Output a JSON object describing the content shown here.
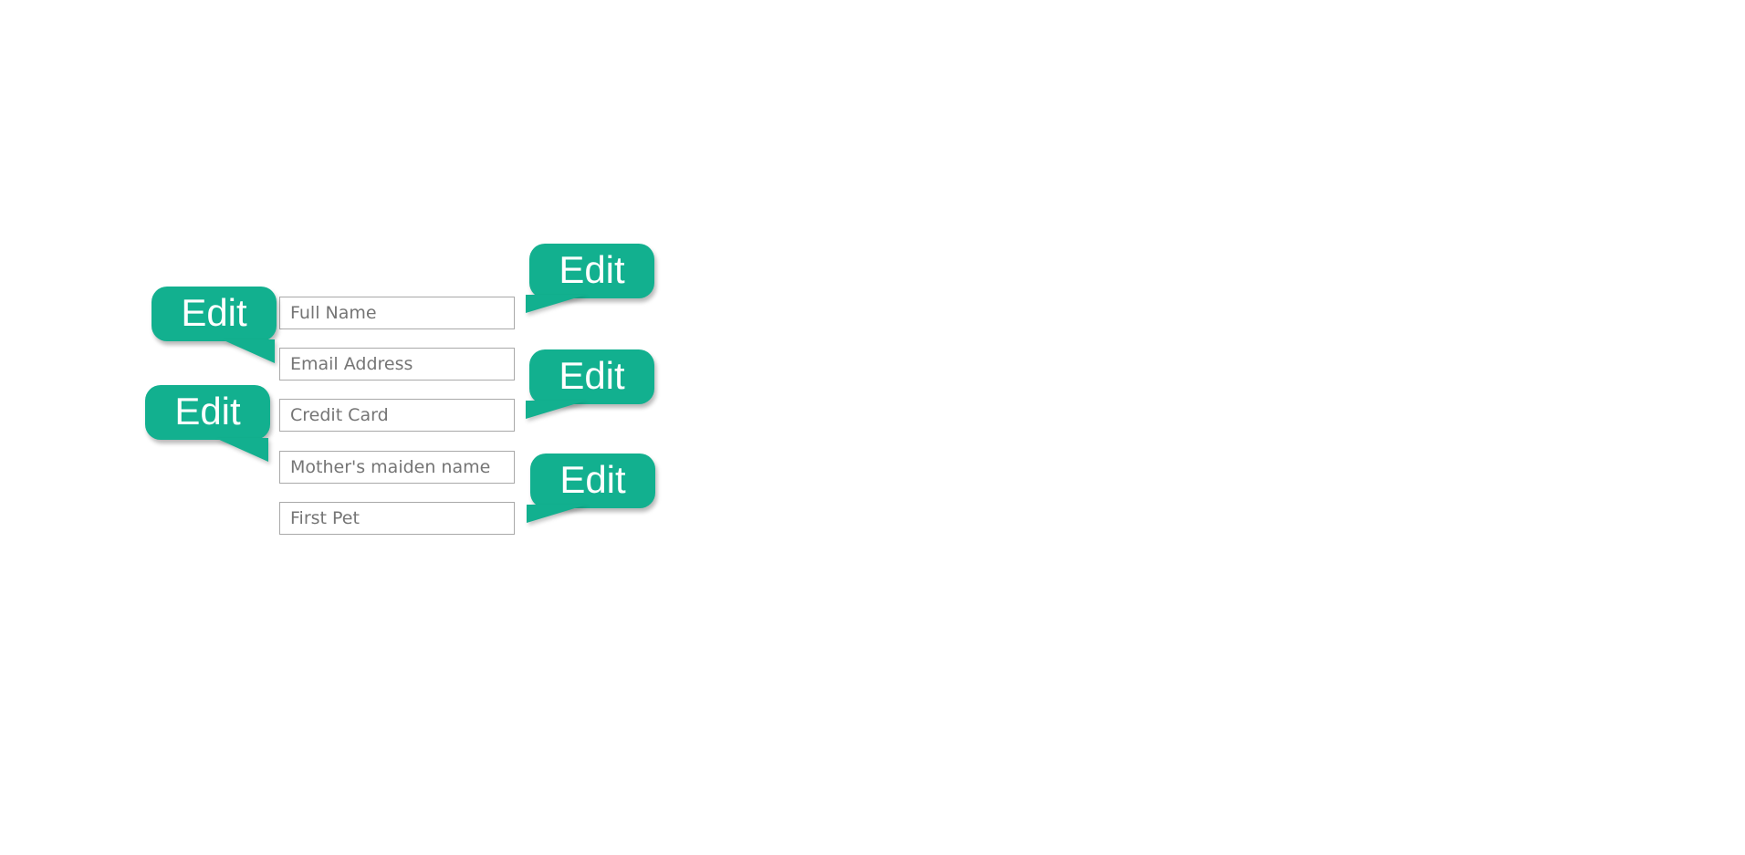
{
  "form": {
    "fields": [
      {
        "placeholder": "Full Name",
        "value": ""
      },
      {
        "placeholder": "Email Address",
        "value": ""
      },
      {
        "placeholder": "Credit Card",
        "value": ""
      },
      {
        "placeholder": "Mother's maiden name",
        "value": ""
      },
      {
        "placeholder": "First Pet",
        "value": ""
      }
    ]
  },
  "bubbles": [
    {
      "label": "Edit"
    },
    {
      "label": "Edit"
    },
    {
      "label": "Edit"
    },
    {
      "label": "Edit"
    },
    {
      "label": "Edit"
    }
  ],
  "colors": {
    "bubble_background": "#12b08f",
    "bubble_text": "#ffffff",
    "field_border": "#a9a9a9",
    "placeholder_text": "#757575",
    "page_background": "#ffffff"
  }
}
